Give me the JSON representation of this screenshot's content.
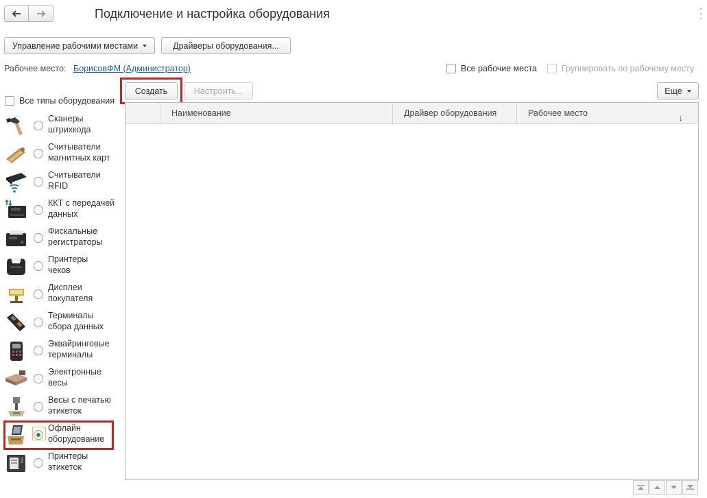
{
  "window": {
    "title": "Подключение и настройка оборудования"
  },
  "toolbar": {
    "workplaces_button": "Управление рабочими местами",
    "drivers_button": "Драйверы оборудования..."
  },
  "workplace": {
    "label": "Рабочее место:",
    "value": "БорисовФМ (Администратор)",
    "all_workplaces": "Все рабочие места",
    "group_by_workplace": "Группировать по рабочему месту"
  },
  "actions": {
    "create": "Создать",
    "configure": "Настроить...",
    "more": "Еще"
  },
  "filters": {
    "all_types": "Все типы оборудования"
  },
  "equipment_types": [
    {
      "line1": "Сканеры",
      "line2": "штрихкода",
      "icon": "barcode-scanner-icon",
      "selected": false
    },
    {
      "line1": "Считыватели",
      "line2": "магнитных карт",
      "icon": "magnetic-card-reader-icon",
      "selected": false
    },
    {
      "line1": "Считыватели",
      "line2": "RFID",
      "icon": "rfid-reader-icon",
      "selected": false
    },
    {
      "line1": "ККТ с передачей",
      "line2": "данных",
      "icon": "online-cash-register-icon",
      "selected": false
    },
    {
      "line1": "Фискальные",
      "line2": "регистраторы",
      "icon": "fiscal-registrar-icon",
      "selected": false
    },
    {
      "line1": "Принтеры",
      "line2": "чеков",
      "icon": "receipt-printer-icon",
      "selected": false
    },
    {
      "line1": "Дисплеи",
      "line2": "покупателя",
      "icon": "customer-display-icon",
      "selected": false
    },
    {
      "line1": "Терминалы",
      "line2": "сбора данных",
      "icon": "data-terminal-icon",
      "selected": false
    },
    {
      "line1": "Эквайринговые",
      "line2": "терминалы",
      "icon": "acquiring-terminal-icon",
      "selected": false
    },
    {
      "line1": "Электронные",
      "line2": "весы",
      "icon": "electronic-scales-icon",
      "selected": false
    },
    {
      "line1": "Весы с печатью",
      "line2": "этикеток",
      "icon": "label-scales-icon",
      "selected": false
    },
    {
      "line1": "Офлайн",
      "line2": "оборудование",
      "icon": "offline-equipment-icon",
      "selected": true
    },
    {
      "line1": "Принтеры",
      "line2": "этикеток",
      "icon": "label-printer-icon",
      "selected": false
    }
  ],
  "grid": {
    "columns": {
      "name": "Наименование",
      "driver": "Драйвер оборудования",
      "workplace": "Рабочее место"
    },
    "sort_symbol": "↓",
    "rows": []
  },
  "colors": {
    "accent_link": "#1b5fa8",
    "highlight": "#d1201c",
    "radio_selected": "#3b8b3b"
  }
}
